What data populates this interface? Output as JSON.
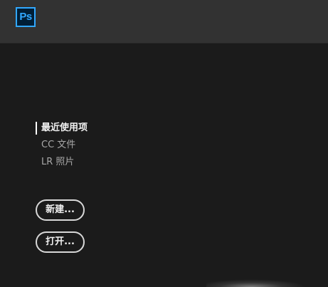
{
  "app": {
    "logo_text": "Ps",
    "logo_color": "#31a8ff",
    "logo_bg": "#001e36"
  },
  "nav": {
    "items": [
      {
        "label": "最近使用项",
        "active": true
      },
      {
        "label": "CC 文件",
        "active": false
      },
      {
        "label": "LR 照片",
        "active": false
      }
    ]
  },
  "actions": {
    "new_label": "新建...",
    "open_label": "打开..."
  }
}
